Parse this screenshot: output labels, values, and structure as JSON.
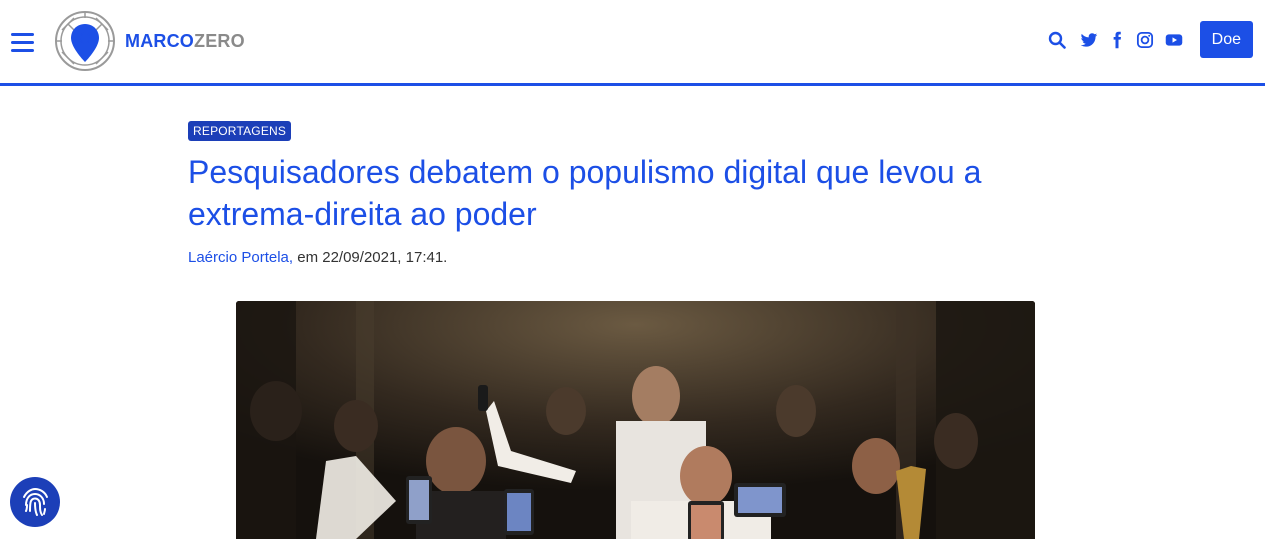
{
  "header": {
    "logo": {
      "part1": "MARCO",
      "part2": "ZERO"
    },
    "icons": [
      "menu-icon",
      "search-icon",
      "twitter-icon",
      "facebook-icon",
      "instagram-icon",
      "youtube-icon"
    ],
    "donate_label": "Doe"
  },
  "article": {
    "category": "REPORTAGENS",
    "title": "Pesquisadores debatem o populismo digital que levou a extrema-direita ao poder",
    "author": "Laércio Portela,",
    "date_text": " em 22/09/2021, 17:41."
  },
  "fab": {
    "icon": "fingerprint-icon"
  },
  "colors": {
    "brand_blue": "#1c4fe6",
    "badge_blue": "#1c3fb8",
    "logo_grey": "#8a8a8a"
  }
}
